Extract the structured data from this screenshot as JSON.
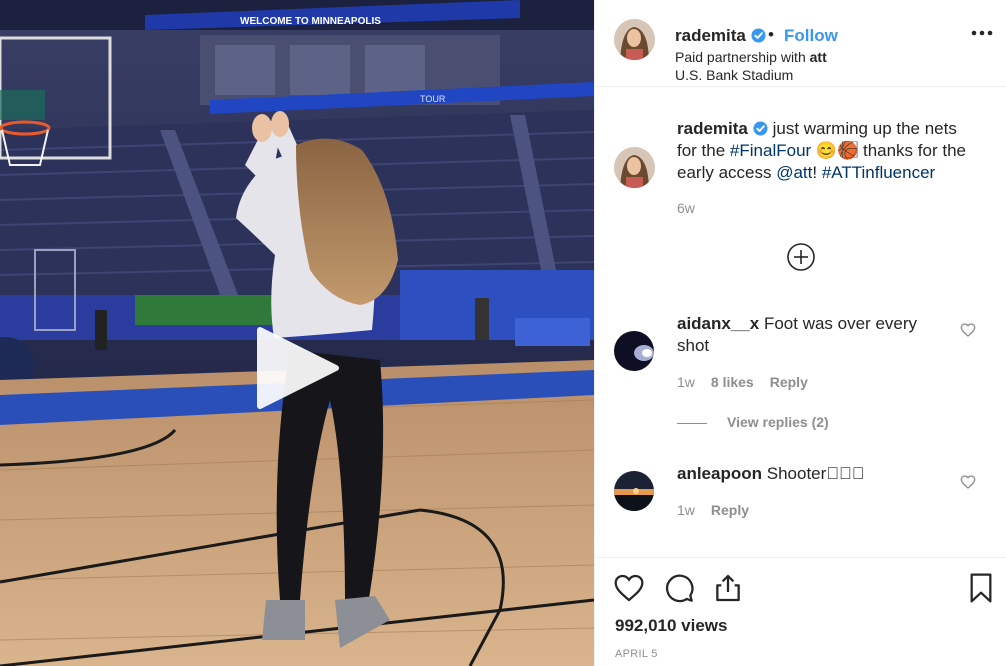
{
  "media": {
    "banner_text": "WELCOME TO MINNEAPOLIS",
    "scoreboard_text": "TOUR",
    "colors": {
      "arena": "#2b2f52",
      "court": "#c9a27a",
      "banner": "#1f3aa8"
    },
    "play_icon": "play-icon"
  },
  "header": {
    "username": "rademita",
    "verified_icon": "verified-badge-icon",
    "separator": "•",
    "follow_label": "Follow",
    "partner_prefix": "Paid partnership with ",
    "partner_name": "att",
    "location": "U.S. Bank Stadium",
    "more_icon": "more-options-icon"
  },
  "caption": {
    "username": "rademita",
    "text_1": " just warming up the nets for the ",
    "hashtag_1": "#FinalFour",
    "emojis": " 😊🏀⃞⃞⃞ ",
    "text_2": "thanks for the early access ",
    "mention": "@att",
    "text_3": "! ",
    "hashtag_2": "#ATTinfluencer",
    "time": "6w"
  },
  "load_more_icon": "plus-circle-icon",
  "comments": [
    {
      "username": "aidanx__x",
      "text": " Foot was over every shot",
      "time": "1w",
      "likes": "8 likes",
      "reply": "Reply",
      "view_replies": "View replies (2)"
    },
    {
      "username": "anleapoon",
      "text": " Shooter⃞⃞⃞",
      "time": "1w",
      "reply": "Reply"
    }
  ],
  "actions": {
    "like_icon": "heart-icon",
    "comment_icon": "comment-icon",
    "share_icon": "share-icon",
    "save_icon": "bookmark-icon"
  },
  "views": "992,010 views",
  "date": "APRIL 5"
}
